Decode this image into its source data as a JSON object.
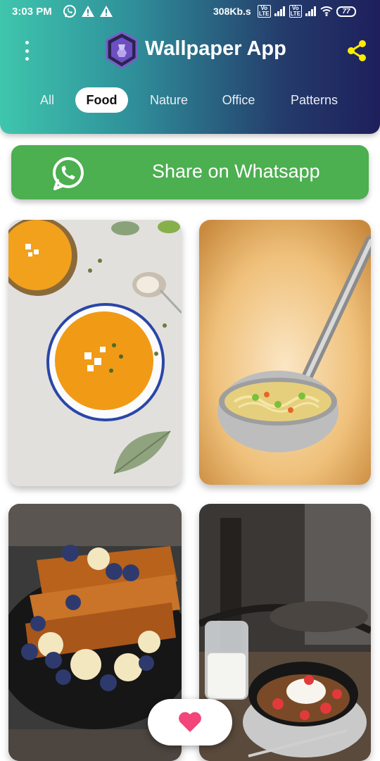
{
  "status_bar": {
    "time": "3:03 PM",
    "net_speed": "308Kb.s",
    "battery": "77"
  },
  "app": {
    "title": "Wallpaper App",
    "header_gradient": [
      "#3fc6ad",
      "#1e1f5c"
    ],
    "menu_icon": "more-vert-icon",
    "share_icon": "share-icon",
    "share_icon_color": "#ffeb00"
  },
  "tabs": [
    {
      "label": "All",
      "active": false
    },
    {
      "label": "Food",
      "active": true
    },
    {
      "label": "Nature",
      "active": false
    },
    {
      "label": "Office",
      "active": false
    },
    {
      "label": "Patterns",
      "active": false
    }
  ],
  "whatsapp_button": {
    "label": "Share on Whatsapp",
    "color": "#4caf50",
    "icon": "whatsapp-icon"
  },
  "wallpapers": [
    {
      "subject": "pumpkin soup bowls"
    },
    {
      "subject": "noodle soup ladle"
    },
    {
      "subject": "french toast with blueberries and banana"
    },
    {
      "subject": "yogurt bowl with strawberries and milk jar"
    }
  ],
  "favorite_button": {
    "icon": "heart-icon",
    "color": "#f2457a"
  }
}
